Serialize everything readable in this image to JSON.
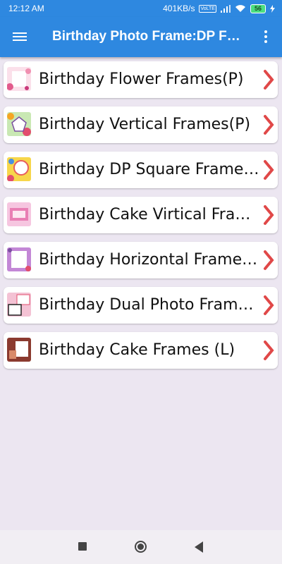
{
  "status_bar": {
    "time": "12:12 AM",
    "net_speed": "401KB/s",
    "volte": "VoLTE",
    "battery": "56"
  },
  "app_bar": {
    "title": "Birthday Photo Frame:DP Frame",
    "menu_icon": "hamburger-menu-icon",
    "more_icon": "more-vert-icon"
  },
  "colors": {
    "primary": "#2e88e0",
    "background": "#ece6f1",
    "arrow": "#e04848"
  },
  "items": [
    {
      "label": "Birthday Flower Frames(P)",
      "thumb": "flower-frame-thumbnail"
    },
    {
      "label": "Birthday Vertical Frames(P)",
      "thumb": "vertical-frame-thumbnail"
    },
    {
      "label": "Birthday DP Square Frame(P)",
      "thumb": "dp-square-frame-thumbnail"
    },
    {
      "label": "Birthday Cake Virtical Frames(P)",
      "thumb": "cake-vertical-frame-thumbnail"
    },
    {
      "label": "Birthday Horizontal Frames(L)",
      "thumb": "horizontal-frame-thumbnail"
    },
    {
      "label": "Birthday Dual Photo Frame(L)",
      "thumb": "dual-photo-frame-thumbnail"
    },
    {
      "label": "Birthday Cake Frames (L)",
      "thumb": "cake-frame-thumbnail"
    }
  ],
  "nav_bar": {
    "recents_icon": "square-recents-icon",
    "home_icon": "circle-home-icon",
    "back_icon": "triangle-back-icon"
  }
}
